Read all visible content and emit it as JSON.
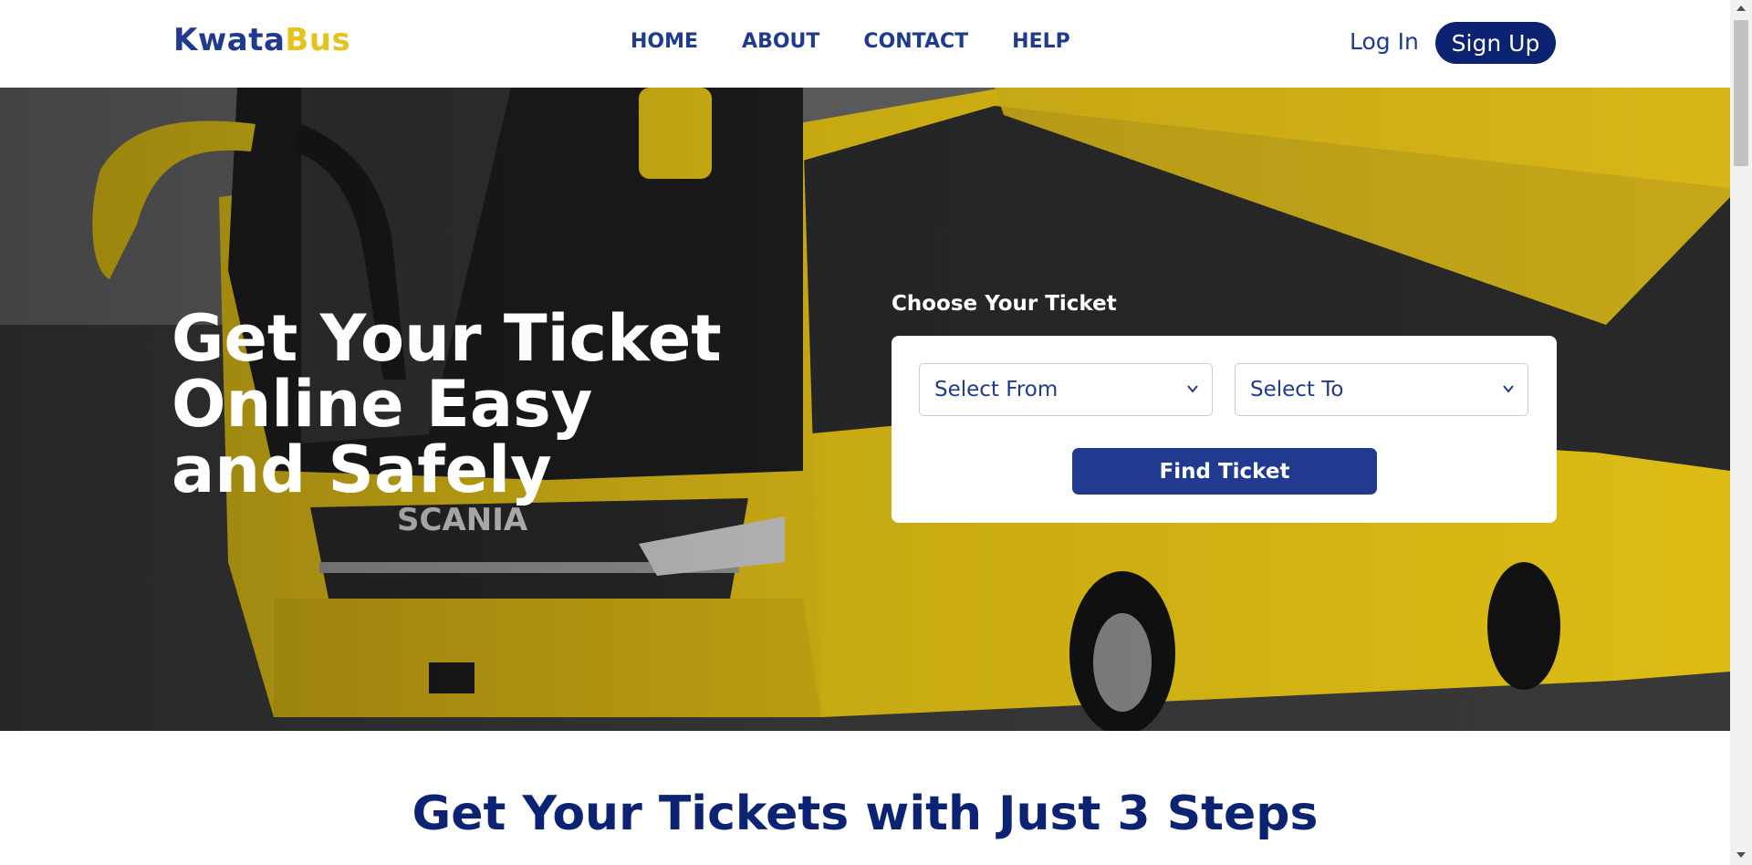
{
  "navbar": {
    "logo_part1": "Kwata",
    "logo_part2": "Bus",
    "links": [
      "HOME",
      "ABOUT",
      "CONTACT",
      "HELP"
    ],
    "login_label": "Log In",
    "signup_label": "Sign Up"
  },
  "hero": {
    "title": "Get Your Ticket Online Easy and Safely",
    "bus_brand": "SCANIA",
    "ticket_label": "Choose Your Ticket",
    "from_selected": "Select From",
    "to_selected": "Select To",
    "find_button": "Find Ticket"
  },
  "steps": {
    "title": "Get Your Tickets with Just 3 Steps"
  },
  "colors": {
    "brand_navy": "#1f3a8f",
    "brand_dark_navy": "#0c2272",
    "brand_yellow": "#e5c21e"
  },
  "icons": {
    "select_chevron": "chevron-down-icon"
  }
}
